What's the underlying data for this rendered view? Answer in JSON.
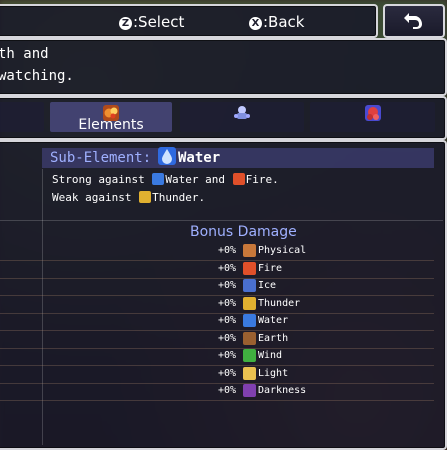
{
  "help": {
    "select_key": "Z",
    "select_label": ":Select",
    "back_key": "X",
    "back_label": ":Back"
  },
  "description": {
    "line1": "th and",
    "line2": "watching."
  },
  "tabs": [
    {
      "label": "",
      "icon": "tab-left-icon"
    },
    {
      "label": "Elements",
      "icon": "elements-icon"
    },
    {
      "label": "",
      "icon": "gear-robot-icon"
    },
    {
      "label": "",
      "icon": "red-creature-icon"
    }
  ],
  "sub_element": {
    "title": "Sub-Element:",
    "value": "Water",
    "strong_prefix": "Strong against",
    "strong_1": "Water",
    "strong_and": "and",
    "strong_2": "Fire.",
    "weak_prefix": "Weak against",
    "weak_1": "Thunder."
  },
  "bonus": {
    "title": "Bonus Damage",
    "rows": [
      {
        "pct": "+0%",
        "name": "Physical",
        "color": "#c8783a"
      },
      {
        "pct": "+0%",
        "name": "Fire",
        "color": "#e0502a"
      },
      {
        "pct": "+0%",
        "name": "Ice",
        "color": "#4a70d0"
      },
      {
        "pct": "+0%",
        "name": "Thunder",
        "color": "#e0b030"
      },
      {
        "pct": "+0%",
        "name": "Water",
        "color": "#3a7ae0"
      },
      {
        "pct": "+0%",
        "name": "Earth",
        "color": "#9a6030"
      },
      {
        "pct": "+0%",
        "name": "Wind",
        "color": "#40b040"
      },
      {
        "pct": "+0%",
        "name": "Light",
        "color": "#e8c050"
      },
      {
        "pct": "+0%",
        "name": "Darkness",
        "color": "#8040b0"
      }
    ]
  }
}
